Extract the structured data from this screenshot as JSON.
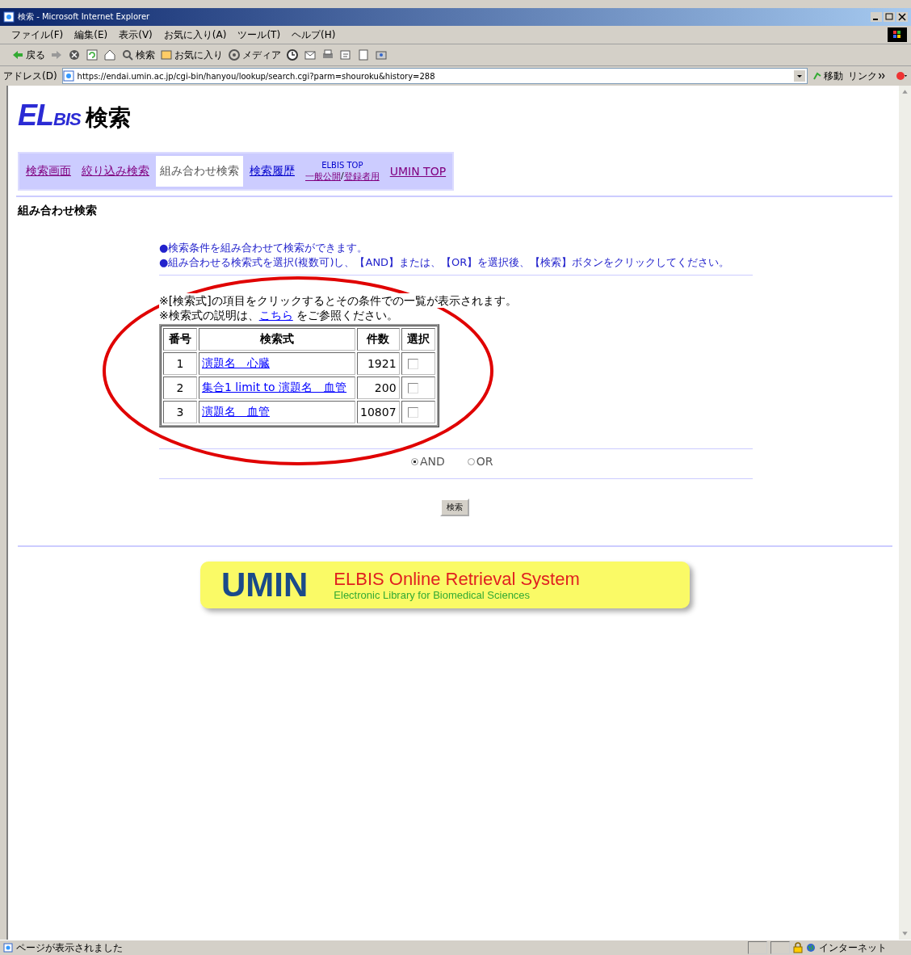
{
  "window": {
    "title": "検索 - Microsoft Internet Explorer"
  },
  "menu": [
    "ファイル(F)",
    "編集(E)",
    "表示(V)",
    "お気に入り(A)",
    "ツール(T)",
    "ヘルプ(H)"
  ],
  "toolbar": [
    {
      "kind": "back",
      "label": "戻る"
    },
    {
      "kind": "forward"
    },
    {
      "kind": "stop"
    },
    {
      "kind": "refresh"
    },
    {
      "kind": "home"
    },
    {
      "kind": "search",
      "label": "検索"
    },
    {
      "kind": "favorites",
      "label": "お気に入り"
    },
    {
      "kind": "media",
      "label": "メディア"
    },
    {
      "kind": "history"
    },
    {
      "kind": "mail"
    },
    {
      "kind": "print"
    },
    {
      "kind": "edit"
    },
    {
      "kind": "discuss"
    },
    {
      "kind": "messenger"
    }
  ],
  "address": {
    "label": "アドレス(D)",
    "url": "https://endai.umin.ac.jp/cgi-bin/hanyou/lookup/search.cgi?parm=shouroku&history=288",
    "go": "移動",
    "links": "リンク"
  },
  "logo": {
    "mark": "EL",
    "sub": "BIS",
    "title": "検索"
  },
  "tabs": [
    {
      "kind": "link",
      "label": "検索画面",
      "selected": false
    },
    {
      "kind": "link",
      "label": "絞り込み検索",
      "selected": false
    },
    {
      "kind": "link",
      "label": "組み合わせ検索",
      "selected": true
    },
    {
      "kind": "link",
      "label": "検索履歴",
      "selected": false
    },
    {
      "kind": "split",
      "label": "ELBIS TOP",
      "links": [
        "一般公開",
        "登録者用"
      ],
      "separator": "/",
      "selected": false
    },
    {
      "kind": "link",
      "label": "UMIN TOP",
      "selected": false
    }
  ],
  "heading": "組み合わせ検索",
  "notes": [
    "●検索条件を組み合わせて検索ができます。",
    "●組み合わせる検索式を選択(複数可)し、【AND】または、【OR】を選択後、【検索】ボタンをクリックしてください。"
  ],
  "hint": "※[検索式]の項目をクリックするとその条件での一覧が表示されます。",
  "help": {
    "before": "※検索式の説明は、",
    "link": "こちら",
    "after": "をご参照ください。"
  },
  "table": {
    "columns": [
      "番号",
      "検索式",
      "件数",
      "選択"
    ],
    "rows": [
      {
        "number": "1",
        "query": "演題名　心臓",
        "count": "1921",
        "checked": false
      },
      {
        "number": "2",
        "query": "集合1 limit to 演題名　血管",
        "count": "200",
        "checked": false
      },
      {
        "number": "3",
        "query": "演題名　血管",
        "count": "10807",
        "checked": false
      }
    ]
  },
  "operators": [
    {
      "label": "AND",
      "selected": true
    },
    {
      "label": "OR",
      "selected": false
    }
  ],
  "search_button": "検索",
  "banner": {
    "brand": "UMIN",
    "title": "ELBIS Online Retrieval System",
    "subtitle": "Electronic Library for Biomedical Sciences"
  },
  "status_bar": {
    "text": "ページが表示されました",
    "zone": "インターネット"
  }
}
